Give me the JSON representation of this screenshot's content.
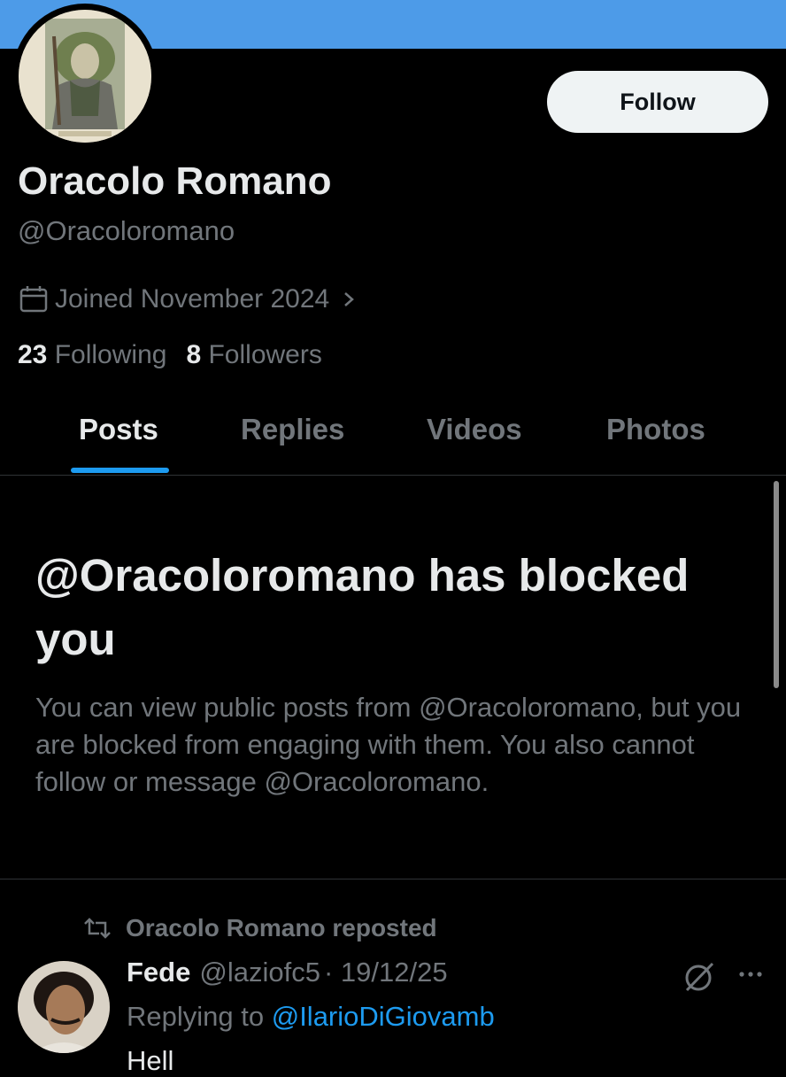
{
  "profile": {
    "display_name": "Oracolo Romano",
    "handle": "@Oracoloromano",
    "joined": "Joined November 2024",
    "following_count": "23",
    "following_label": "Following",
    "followers_count": "8",
    "followers_label": "Followers",
    "follow_label": "Follow",
    "banner_color": "#4d9be8"
  },
  "tabs": [
    {
      "label": "Posts",
      "active": true
    },
    {
      "label": "Replies",
      "active": false
    },
    {
      "label": "Videos",
      "active": false
    },
    {
      "label": "Photos",
      "active": false
    }
  ],
  "blocked": {
    "title": "@Oracoloromano has blocked you",
    "description": "You can view public posts from @Oracoloromano, but you are blocked from engaging with them. You also cannot follow or message @Oracoloromano."
  },
  "post": {
    "repost_label": "Oracolo Romano reposted",
    "author": "Fede",
    "handle": "@laziofc5",
    "date": "· 19/12/25",
    "replying_prefix": "Replying to",
    "replying_handle": "@IlarioDiGiovamb",
    "text": "Hell"
  },
  "icons": {
    "calendar": "calendar-icon",
    "chevron": "chevron-right-icon",
    "repost": "repost-icon",
    "grok": "grok-icon",
    "more": "more-icon"
  },
  "colors": {
    "accent": "#1d9bf0",
    "muted": "#71767b",
    "text": "#e7e9ea",
    "background": "#000000"
  }
}
